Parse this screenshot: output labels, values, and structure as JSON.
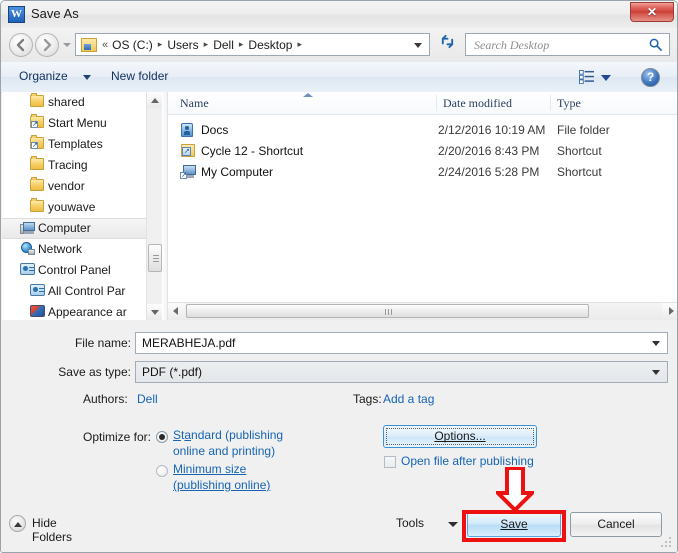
{
  "window": {
    "title": "Save As",
    "app_icon": "word-icon",
    "app_icon_letter": "W",
    "close_label": "✕"
  },
  "nav": {
    "back_icon": "back-arrow-icon",
    "forward_icon": "forward-arrow-icon",
    "history_icon": "history-dropdown-icon",
    "breadcrumb": [
      "OS (C:)",
      "Users",
      "Dell",
      "Desktop"
    ],
    "breadcrumb_prefix": "«",
    "breadcrumb_separator": "▸",
    "refresh_icon": "refresh-icon",
    "address_dropdown_icon": "chevron-down-icon"
  },
  "search": {
    "placeholder": "Search Desktop",
    "value": "",
    "icon": "search-icon"
  },
  "toolbar": {
    "organize_label": "Organize",
    "organize_caret_icon": "chevron-down-icon",
    "new_folder_label": "New folder",
    "view_icon": "list-view-icon",
    "view_caret_icon": "chevron-down-icon",
    "help_icon": "help-icon",
    "help_label": "?"
  },
  "sidebar": {
    "items": [
      {
        "label": "shared",
        "icon": "folder-icon",
        "indent": 46,
        "selected": false
      },
      {
        "label": "Start Menu",
        "icon": "shortcut-folder-icon",
        "indent": 46,
        "selected": false
      },
      {
        "label": "Templates",
        "icon": "shortcut-folder-icon",
        "indent": 46,
        "selected": false
      },
      {
        "label": "Tracing",
        "icon": "folder-icon",
        "indent": 46,
        "selected": false
      },
      {
        "label": "vendor",
        "icon": "folder-icon",
        "indent": 46,
        "selected": false
      },
      {
        "label": "youwave",
        "icon": "folder-icon",
        "indent": 46,
        "selected": false
      },
      {
        "label": "Computer",
        "icon": "computer-icon",
        "indent": 36,
        "selected": true
      },
      {
        "label": "Network",
        "icon": "network-icon",
        "indent": 36,
        "selected": false
      },
      {
        "label": "Control Panel",
        "icon": "control-panel-icon",
        "indent": 36,
        "selected": false
      },
      {
        "label": "All Control Par",
        "icon": "control-panel-icon",
        "indent": 46,
        "selected": false
      },
      {
        "label": "Appearance ar",
        "icon": "appearance-icon",
        "indent": 46,
        "selected": false
      }
    ],
    "scroll_up_icon": "scroll-up-arrow-icon",
    "scroll_down_icon": "scroll-down-arrow-icon"
  },
  "filelist": {
    "columns": [
      "Name",
      "Date modified",
      "Type"
    ],
    "sort_indicator": "sort-ascending-icon",
    "rows": [
      {
        "name": "Docs",
        "date": "2/12/2016 10:19 AM",
        "type": "File folder",
        "icon": "docs-folder-icon"
      },
      {
        "name": "Cycle 12 - Shortcut",
        "date": "2/20/2016 8:43 PM",
        "type": "Shortcut",
        "icon": "folder-shortcut-icon"
      },
      {
        "name": "My Computer",
        "date": "2/24/2016 5:28 PM",
        "type": "Shortcut",
        "icon": "computer-shortcut-icon"
      }
    ],
    "hscroll_left_icon": "scroll-left-arrow-icon",
    "hscroll_right_icon": "scroll-right-arrow-icon"
  },
  "form": {
    "file_name_label": "File name:",
    "file_name_value": "MERABHEJA.pdf",
    "save_as_type_label": "Save as type:",
    "save_as_type_value": "PDF (*.pdf)",
    "authors_label": "Authors:",
    "authors_value": "Dell",
    "tags_label": "Tags:",
    "tags_value": "Add a tag",
    "optimize_label": "Optimize for:",
    "optimize_options": [
      {
        "line1": "Standard (publishing",
        "line2": "online and printing)",
        "selected": true
      },
      {
        "line1": "Minimum size",
        "line2": "(publishing online)",
        "selected": false
      }
    ],
    "options_button": "Options...",
    "open_after_publishing_label": "Open file after publishing",
    "open_after_publishing_checked": false
  },
  "footer": {
    "hide_folders_label": "Hide Folders",
    "hide_folders_icon": "collapse-up-icon",
    "tools_label": "Tools",
    "tools_caret_icon": "chevron-down-icon",
    "save_label": "Save",
    "cancel_label": "Cancel",
    "resize_grip_icon": "resize-grip-icon"
  },
  "annotation": {
    "arrow_icon": "red-down-arrow-annotation",
    "highlight_target": "save-button",
    "color": "#ee1111"
  },
  "colors": {
    "accent_blue": "#1763b5",
    "title_bg": "#f0f0f0",
    "close_red": "#cc3c33",
    "annotation_red": "#ee1111"
  }
}
